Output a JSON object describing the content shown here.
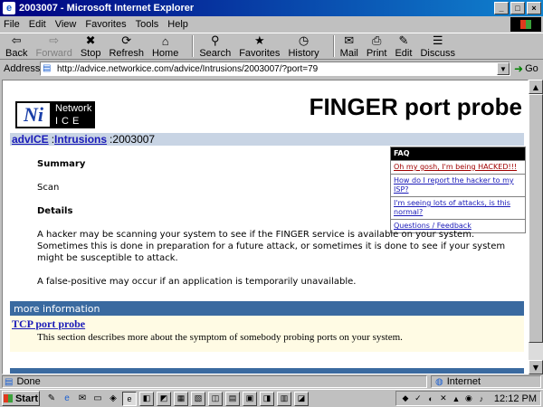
{
  "window": {
    "title": "2003007 - Microsoft Internet Explorer",
    "min_label": "_",
    "max_label": "□",
    "close_label": "×"
  },
  "menu": [
    "File",
    "Edit",
    "View",
    "Favorites",
    "Tools",
    "Help"
  ],
  "toolbar": {
    "buttons": [
      {
        "label": "Back",
        "icon": "back-arrow-icon",
        "glyph": "⇦",
        "enabled": true
      },
      {
        "label": "Forward",
        "icon": "forward-arrow-icon",
        "glyph": "⇨",
        "enabled": false
      },
      {
        "label": "Stop",
        "icon": "stop-icon",
        "glyph": "✖",
        "enabled": true
      },
      {
        "label": "Refresh",
        "icon": "refresh-icon",
        "glyph": "⟳",
        "enabled": true
      },
      {
        "label": "Home",
        "icon": "home-icon",
        "glyph": "⌂",
        "enabled": true
      },
      {
        "label": "Search",
        "icon": "search-icon",
        "glyph": "⚲",
        "enabled": true
      },
      {
        "label": "Favorites",
        "icon": "favorites-icon",
        "glyph": "★",
        "enabled": true
      },
      {
        "label": "History",
        "icon": "history-icon",
        "glyph": "◷",
        "enabled": true
      },
      {
        "label": "Mail",
        "icon": "mail-icon",
        "glyph": "✉",
        "enabled": true
      },
      {
        "label": "Print",
        "icon": "print-icon",
        "glyph": "⎙",
        "enabled": true
      },
      {
        "label": "Edit",
        "icon": "edit-icon",
        "glyph": "✎",
        "enabled": true
      },
      {
        "label": "Discuss",
        "icon": "discuss-icon",
        "glyph": "☰",
        "enabled": true
      }
    ]
  },
  "address": {
    "label": "Address",
    "url": "http://advice.networkice.com/advice/Intrusions/2003007/?port=79",
    "go_label": "Go"
  },
  "page": {
    "logo_top": "Network",
    "logo_bottom": "ICE",
    "title": "FINGER port probe",
    "breadcrumb": {
      "link1": "advICE",
      "sep1": ":",
      "link2": "Intrusions",
      "sep2": ":",
      "current": "2003007"
    },
    "summary_heading": "Summary",
    "summary_text": "Scan",
    "details_heading": "Details",
    "details_p1": "A hacker may be scanning your system to see if the FINGER service is available on your system. Sometimes this is done in preparation for a future attack, or sometimes it is done to see if your system might be susceptible to attack.",
    "details_p2": "A false-positive may occur if an application is temporarily unavailable.",
    "faq": {
      "heading": "FAQ",
      "items": [
        "Oh my gosh, I'm being HACKED!!!",
        "How do I report the hacker to my ISP?",
        "I'm seeing lots of attacks, is this normal?",
        "Questions / Feedback"
      ]
    },
    "more_info_heading": "more information",
    "more_info_link": "TCP port probe",
    "more_info_text": "This section describes more about the symptom of somebody probing ports on your system."
  },
  "status": {
    "text": "Done",
    "zone": "Internet"
  },
  "taskbar": {
    "start_label": "Start",
    "clock": "12:12 PM"
  }
}
